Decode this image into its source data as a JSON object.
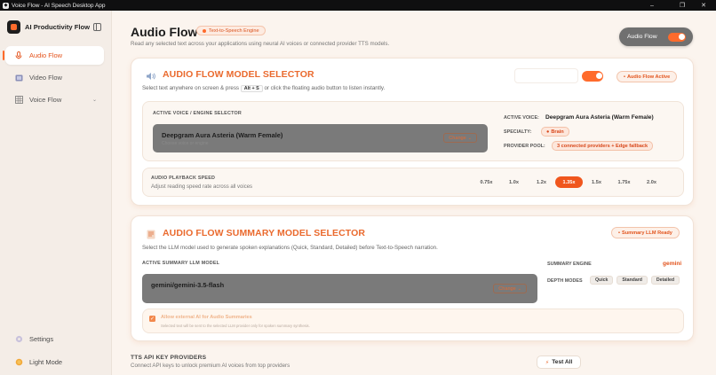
{
  "window": {
    "title": "Voice Flow - AI Speech Desktop App",
    "controls": [
      "–",
      "❐",
      "✕"
    ]
  },
  "sidebar": {
    "brand": "AI Productivity Flow",
    "items": [
      {
        "label": "Audio Flow",
        "icon": "mic-icon",
        "active": true
      },
      {
        "label": "Video Flow",
        "icon": "video-icon",
        "active": false
      },
      {
        "label": "Voice Flow",
        "icon": "grid-icon",
        "active": false,
        "chevron": "⌄"
      }
    ],
    "bottom": [
      {
        "label": "Settings",
        "icon": "gear-icon"
      },
      {
        "label": "Light Mode",
        "icon": "sun-icon"
      }
    ]
  },
  "header": {
    "title": "Audio Flow",
    "chip": "Text-to-Speech Engine",
    "subtitle": "Read any selected text across your applications using neural AI voices or connected provider TTS models.",
    "toggle_label": "Audio Flow",
    "toggle_on": true
  },
  "model_selector": {
    "title": "AUDIO FLOW MODEL SELECTOR",
    "desc_before": "Select text anywhere on screen & press",
    "shortcut": "Alt + S",
    "desc_after": "or click the floating audio button to listen instantly.",
    "status": "Audio Flow Active",
    "voice_section_label": "ACTIVE VOICE / ENGINE SELECTOR",
    "voice_value": "Deepgram Aura Asteria (Warm Female)",
    "voice_hint": "Choose voice or engine",
    "change_label": "Change",
    "active_voice_key": "ACTIVE VOICE:",
    "active_voice_value": "Deepgram Aura Asteria (Warm Female)",
    "specialty_key": "SPECIALTY:",
    "specialty_value": "Brain",
    "provider_key": "PROVIDER POOL:",
    "provider_value": "3 connected providers + Edge fallback",
    "speed_label": "AUDIO PLAYBACK SPEED",
    "speed_desc": "Adjust reading speed rate across all voices",
    "speeds": [
      "0.75x",
      "1.0x",
      "1.2x",
      "1.35x",
      "1.5x",
      "1.75x",
      "2.0x"
    ],
    "selected_speed": "1.35x"
  },
  "summary_selector": {
    "title": "AUDIO FLOW SUMMARY MODEL SELECTOR",
    "desc": "Select the LLM model used to generate spoken explanations (Quick, Standard, Detailed) before Text-to-Speech narration.",
    "status": "Summary LLM Ready",
    "model_label": "ACTIVE SUMMARY LLM MODEL",
    "model_value": "gemini/gemini-3.5-flash",
    "change_label": "Change",
    "engine_key": "SUMMARY ENGINE",
    "engine_value": "gemini",
    "depth_key": "DEPTH MODES",
    "depth_modes": [
      "Quick",
      "Standard",
      "Detailed"
    ],
    "external_label": "Allow external AI for Audio Summaries",
    "external_note": "Selected text will be sent to the selected LLM provider only for spoken summary synthesis.",
    "external_checked": true
  },
  "api_keys": {
    "title": "TTS API KEY PROVIDERS",
    "desc": "Connect API keys to unlock premium AI voices from top providers",
    "test_all": "Test All"
  }
}
